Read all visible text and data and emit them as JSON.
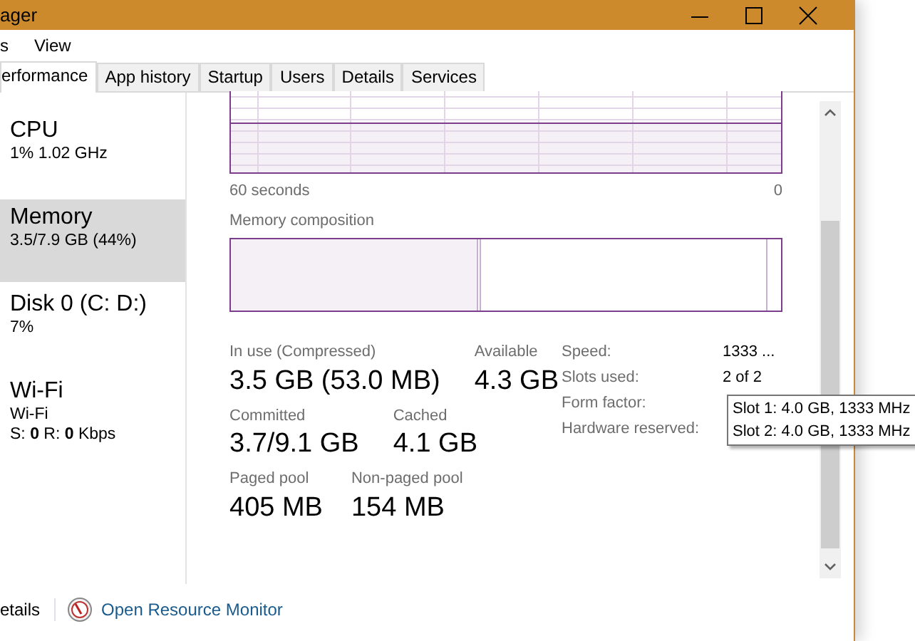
{
  "window": {
    "title": "ager"
  },
  "menu": [
    "s",
    "View"
  ],
  "tabs": [
    {
      "label": "erformance",
      "selected": true
    },
    {
      "label": "App history",
      "selected": false
    },
    {
      "label": "Startup",
      "selected": false
    },
    {
      "label": "Users",
      "selected": false
    },
    {
      "label": "Details",
      "selected": false
    },
    {
      "label": "Services",
      "selected": false
    }
  ],
  "sidebar": {
    "items": [
      {
        "name": "CPU",
        "details": [
          "1% 1.02 GHz"
        ],
        "selected": false
      },
      {
        "name": "Memory",
        "details": [
          "3.5/7.9 GB (44%)"
        ],
        "selected": true
      },
      {
        "name": "Disk 0 (C: D:)",
        "details": [
          "7%"
        ],
        "selected": false
      },
      {
        "name": "Wi-Fi",
        "details": [
          "Wi-Fi",
          "S: **0** R: **0** Kbps"
        ],
        "selected": false
      }
    ]
  },
  "graph": {
    "time_label": "60 seconds",
    "end_label": "0"
  },
  "composition": {
    "title": "Memory composition"
  },
  "stats": [
    [
      {
        "label": "In use (Compressed)",
        "value": "3.5 GB (53.0 MB)"
      },
      {
        "label": "Available",
        "value": "4.3 GB"
      }
    ],
    [
      {
        "label": "Committed",
        "value": "3.7/9.1 GB"
      },
      {
        "label": "Cached",
        "value": "4.1 GB"
      }
    ],
    [
      {
        "label": "Paged pool",
        "value": "405 MB"
      },
      {
        "label": "Non-paged pool",
        "value": "154 MB"
      }
    ]
  ],
  "hardware": [
    {
      "label": "Speed:",
      "value": "1333 ..."
    },
    {
      "label": "Slots used:",
      "value": "2 of 2"
    },
    {
      "label": "Form factor:"
    },
    {
      "label": "Hardware reserved:"
    }
  ],
  "tooltip": [
    "Slot 1: 4.0 GB, 1333 MHz",
    "Slot 2: 4.0 GB, 1333 MHz"
  ],
  "footer": {
    "details": "etails",
    "link": "Open Resource Monitor"
  }
}
